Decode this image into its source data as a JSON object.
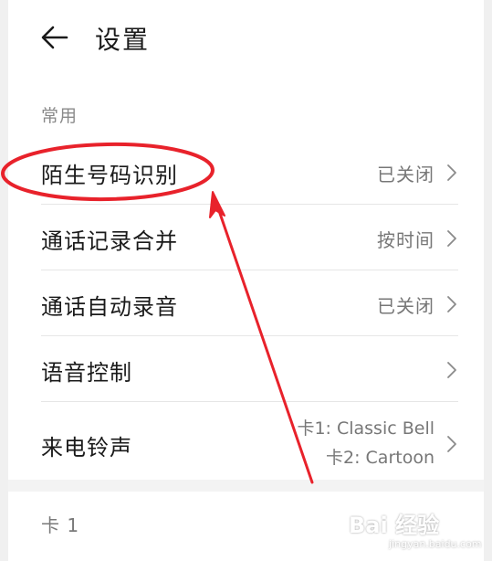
{
  "header": {
    "title": "设置",
    "back_icon": "back-arrow-icon"
  },
  "section": {
    "label": "常用"
  },
  "rows": [
    {
      "title": "陌生号码识别",
      "value": "已关闭"
    },
    {
      "title": "通话记录合并",
      "value": "按时间"
    },
    {
      "title": "通话自动录音",
      "value": "已关闭"
    },
    {
      "title": "语音控制",
      "value": ""
    },
    {
      "title": "来电铃声",
      "value_line1": "卡1: Classic Bell",
      "value_line2": "卡2: Cartoon"
    }
  ],
  "sim_section": {
    "label": "卡 1"
  },
  "annotation": {
    "color": "#e8222b",
    "type": "ellipse-and-arrow"
  },
  "watermark": {
    "main": "Bai 经验",
    "sub": "jingyan.baidu.com"
  }
}
